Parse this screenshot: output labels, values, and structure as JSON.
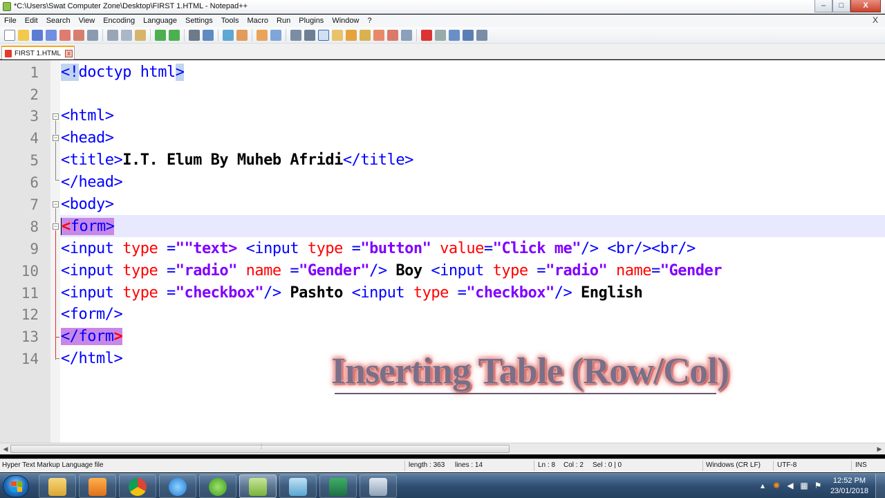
{
  "window": {
    "title": "*C:\\Users\\Swat Computer Zone\\Desktop\\FIRST 1.HTML - Notepad++",
    "min": "–",
    "max": "□",
    "close": "X"
  },
  "menu": [
    "File",
    "Edit",
    "Search",
    "View",
    "Encoding",
    "Language",
    "Settings",
    "Tools",
    "Macro",
    "Run",
    "Plugins",
    "Window",
    "?"
  ],
  "menu_close": "X",
  "tab": {
    "label": "FIRST 1.HTML",
    "close": "x"
  },
  "line_numbers": [
    "1",
    "2",
    "3",
    "4",
    "5",
    "6",
    "7",
    "8",
    "9",
    "10",
    "11",
    "12",
    "13",
    "14"
  ],
  "code": {
    "l1": {
      "a": "<!",
      "b": "doctyp html",
      "c": ">"
    },
    "l3": {
      "a": "<html>"
    },
    "l4": {
      "a": "<head>"
    },
    "l5": {
      "a": "<title>",
      "b": "I.T. Elum By Muheb Afridi",
      "c": "</title>"
    },
    "l6": {
      "a": "</head>"
    },
    "l7": {
      "a": "<body>"
    },
    "l8": {
      "a": "<",
      "b": "form>"
    },
    "l9": {
      "a": "<input ",
      "b": "type",
      "c": " =",
      "d": "\"\"text>",
      "e": " <input ",
      "f": "type",
      "g": " =",
      "h": "\"button\"",
      "i": " value",
      "j": "=",
      "k": "\"Click me\"",
      "l": "/> <br/><br/>"
    },
    "l10": {
      "a": "<input ",
      "b": "type",
      "c": " =",
      "d": "\"radio\"",
      "e": " name",
      "f": " =",
      "g": "\"Gender\"",
      "h": "/>",
      "i": " Boy ",
      "j": "<input ",
      "k": "type",
      "l": " =",
      "m": "\"radio\"",
      "n": " name",
      "o": "=",
      "p": "\"Gender"
    },
    "l11": {
      "a": "<input ",
      "b": "type",
      "c": " =",
      "d": "\"checkbox\"",
      "e": "/>",
      "f": " Pashto ",
      "g": "<input ",
      "h": "type",
      "i": " =",
      "j": "\"checkbox\"",
      "k": "/>",
      "l": " English"
    },
    "l12": {
      "a": "<form/>"
    },
    "l13": {
      "a": "</form",
      "b": ">"
    },
    "l14": {
      "a": "</html>"
    }
  },
  "overlay_title": "Inserting Table (Row/Col)",
  "status": {
    "file_type": "Hyper Text Markup Language file",
    "length": "length : 363",
    "lines": "lines : 14",
    "ln": "Ln : 8",
    "col": "Col : 2",
    "sel": "Sel : 0 | 0",
    "eol": "Windows (CR LF)",
    "encoding": "UTF-8",
    "mode": "INS"
  },
  "clock": {
    "time": "12:52 PM",
    "date": "23/01/2018"
  },
  "colors": {
    "tag": "#0000ff",
    "attr": "#ff0000",
    "value": "#8000ff",
    "current_line": "#e8e8ff",
    "gutter": "#e4e4e4"
  }
}
